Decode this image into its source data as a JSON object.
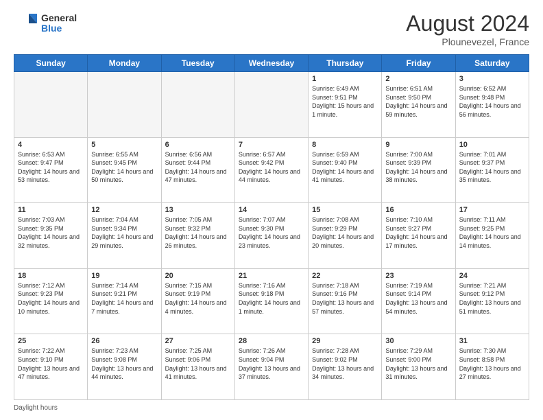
{
  "header": {
    "logo_general": "General",
    "logo_blue": "Blue",
    "month_title": "August 2024",
    "subtitle": "Plounevezel, France"
  },
  "days_of_week": [
    "Sunday",
    "Monday",
    "Tuesday",
    "Wednesday",
    "Thursday",
    "Friday",
    "Saturday"
  ],
  "footer": {
    "daylight_label": "Daylight hours"
  },
  "weeks": [
    {
      "days": [
        {
          "num": "",
          "empty": true
        },
        {
          "num": "",
          "empty": true
        },
        {
          "num": "",
          "empty": true
        },
        {
          "num": "",
          "empty": true
        },
        {
          "num": "1",
          "sunrise": "6:49 AM",
          "sunset": "9:51 PM",
          "daylight": "15 hours and 1 minute."
        },
        {
          "num": "2",
          "sunrise": "6:51 AM",
          "sunset": "9:50 PM",
          "daylight": "14 hours and 59 minutes."
        },
        {
          "num": "3",
          "sunrise": "6:52 AM",
          "sunset": "9:48 PM",
          "daylight": "14 hours and 56 minutes."
        }
      ]
    },
    {
      "days": [
        {
          "num": "4",
          "sunrise": "6:53 AM",
          "sunset": "9:47 PM",
          "daylight": "14 hours and 53 minutes."
        },
        {
          "num": "5",
          "sunrise": "6:55 AM",
          "sunset": "9:45 PM",
          "daylight": "14 hours and 50 minutes."
        },
        {
          "num": "6",
          "sunrise": "6:56 AM",
          "sunset": "9:44 PM",
          "daylight": "14 hours and 47 minutes."
        },
        {
          "num": "7",
          "sunrise": "6:57 AM",
          "sunset": "9:42 PM",
          "daylight": "14 hours and 44 minutes."
        },
        {
          "num": "8",
          "sunrise": "6:59 AM",
          "sunset": "9:40 PM",
          "daylight": "14 hours and 41 minutes."
        },
        {
          "num": "9",
          "sunrise": "7:00 AM",
          "sunset": "9:39 PM",
          "daylight": "14 hours and 38 minutes."
        },
        {
          "num": "10",
          "sunrise": "7:01 AM",
          "sunset": "9:37 PM",
          "daylight": "14 hours and 35 minutes."
        }
      ]
    },
    {
      "days": [
        {
          "num": "11",
          "sunrise": "7:03 AM",
          "sunset": "9:35 PM",
          "daylight": "14 hours and 32 minutes."
        },
        {
          "num": "12",
          "sunrise": "7:04 AM",
          "sunset": "9:34 PM",
          "daylight": "14 hours and 29 minutes."
        },
        {
          "num": "13",
          "sunrise": "7:05 AM",
          "sunset": "9:32 PM",
          "daylight": "14 hours and 26 minutes."
        },
        {
          "num": "14",
          "sunrise": "7:07 AM",
          "sunset": "9:30 PM",
          "daylight": "14 hours and 23 minutes."
        },
        {
          "num": "15",
          "sunrise": "7:08 AM",
          "sunset": "9:29 PM",
          "daylight": "14 hours and 20 minutes."
        },
        {
          "num": "16",
          "sunrise": "7:10 AM",
          "sunset": "9:27 PM",
          "daylight": "14 hours and 17 minutes."
        },
        {
          "num": "17",
          "sunrise": "7:11 AM",
          "sunset": "9:25 PM",
          "daylight": "14 hours and 14 minutes."
        }
      ]
    },
    {
      "days": [
        {
          "num": "18",
          "sunrise": "7:12 AM",
          "sunset": "9:23 PM",
          "daylight": "14 hours and 10 minutes."
        },
        {
          "num": "19",
          "sunrise": "7:14 AM",
          "sunset": "9:21 PM",
          "daylight": "14 hours and 7 minutes."
        },
        {
          "num": "20",
          "sunrise": "7:15 AM",
          "sunset": "9:19 PM",
          "daylight": "14 hours and 4 minutes."
        },
        {
          "num": "21",
          "sunrise": "7:16 AM",
          "sunset": "9:18 PM",
          "daylight": "14 hours and 1 minute."
        },
        {
          "num": "22",
          "sunrise": "7:18 AM",
          "sunset": "9:16 PM",
          "daylight": "13 hours and 57 minutes."
        },
        {
          "num": "23",
          "sunrise": "7:19 AM",
          "sunset": "9:14 PM",
          "daylight": "13 hours and 54 minutes."
        },
        {
          "num": "24",
          "sunrise": "7:21 AM",
          "sunset": "9:12 PM",
          "daylight": "13 hours and 51 minutes."
        }
      ]
    },
    {
      "days": [
        {
          "num": "25",
          "sunrise": "7:22 AM",
          "sunset": "9:10 PM",
          "daylight": "13 hours and 47 minutes."
        },
        {
          "num": "26",
          "sunrise": "7:23 AM",
          "sunset": "9:08 PM",
          "daylight": "13 hours and 44 minutes."
        },
        {
          "num": "27",
          "sunrise": "7:25 AM",
          "sunset": "9:06 PM",
          "daylight": "13 hours and 41 minutes."
        },
        {
          "num": "28",
          "sunrise": "7:26 AM",
          "sunset": "9:04 PM",
          "daylight": "13 hours and 37 minutes."
        },
        {
          "num": "29",
          "sunrise": "7:28 AM",
          "sunset": "9:02 PM",
          "daylight": "13 hours and 34 minutes."
        },
        {
          "num": "30",
          "sunrise": "7:29 AM",
          "sunset": "9:00 PM",
          "daylight": "13 hours and 31 minutes."
        },
        {
          "num": "31",
          "sunrise": "7:30 AM",
          "sunset": "8:58 PM",
          "daylight": "13 hours and 27 minutes."
        }
      ]
    }
  ]
}
